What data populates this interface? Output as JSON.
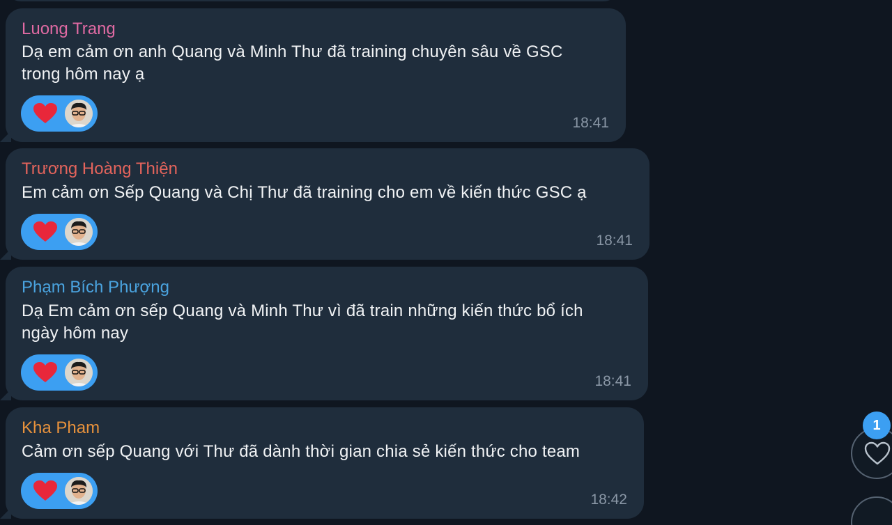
{
  "messages": [
    {
      "sender": "Luong Trang",
      "sender_color": "#e06aa3",
      "lines": [
        "Dạ em cảm ơn anh Quang và Minh Thư đã training chuyên sâu về GSC",
        "trong hôm nay ạ"
      ],
      "reaction": {
        "icon": "heart-icon",
        "reactor": "avatar"
      },
      "time": "18:41"
    },
    {
      "sender": "Trương Hoàng Thiện",
      "sender_color": "#e4645c",
      "lines": [
        "Em cảm ơn Sếp Quang và Chị Thư đã training cho em về kiến thức GSC ạ"
      ],
      "reaction": {
        "icon": "heart-icon",
        "reactor": "avatar"
      },
      "time": "18:41"
    },
    {
      "sender": "Phạm Bích Phượng",
      "sender_color": "#4aa3df",
      "lines": [
        "Dạ Em cảm ơn sếp Quang và Minh Thư vì đã train những kiến thức bổ ích",
        "ngày hôm nay"
      ],
      "reaction": {
        "icon": "heart-icon",
        "reactor": "avatar"
      },
      "time": "18:41"
    },
    {
      "sender": "Kha Pham",
      "sender_color": "#e8923c",
      "lines": [
        "Cảm ơn sếp Quang với Thư đã dành thời gian chia sẻ kiến thức cho team"
      ],
      "reaction": {
        "icon": "heart-icon",
        "reactor": "avatar"
      },
      "time": "18:42"
    }
  ],
  "side_controls": {
    "reactions_badge": "1",
    "reactions_icon": "heart-outline-icon",
    "scroll_icon": "chevron-down-icon"
  },
  "colors": {
    "background": "#0f1620",
    "bubble": "#1f2d3c",
    "reaction_pill": "#3c9ff2",
    "heart": "#e8273a",
    "time": "#8a97a6"
  }
}
